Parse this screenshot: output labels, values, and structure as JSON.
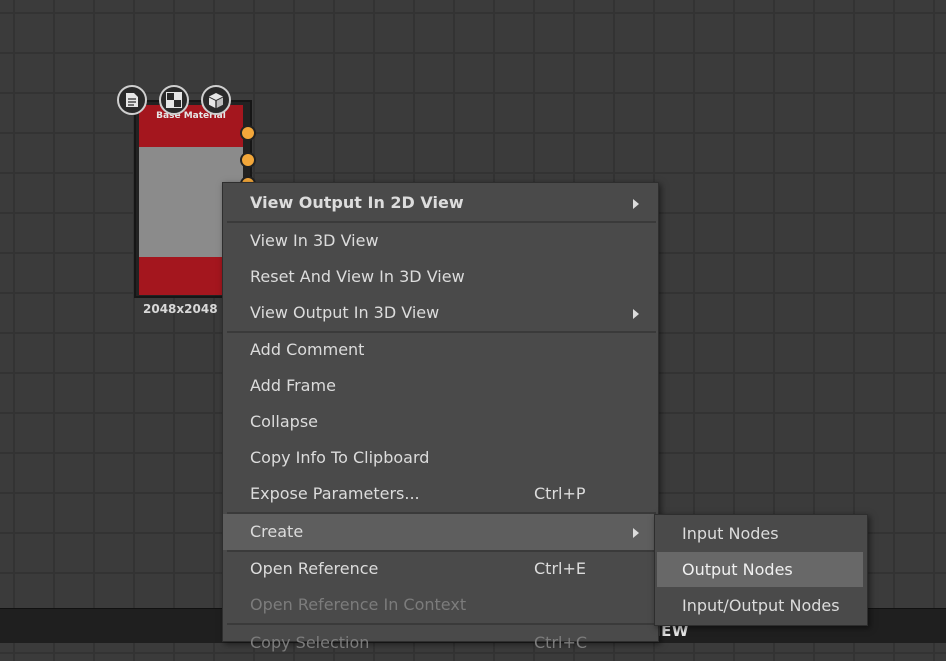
{
  "node": {
    "title": "Base Material",
    "size_label": "2048x2048 -",
    "icons": [
      "document-icon",
      "checker-icon",
      "cube-icon"
    ],
    "port_color": "#f3a73a",
    "header_color": "#a4161e"
  },
  "context_menu": {
    "items": [
      {
        "label": "View Output In 2D View",
        "shortcut": "",
        "submenu": true
      },
      {
        "label": "View In 3D View",
        "shortcut": ""
      },
      {
        "label": "Reset And View In 3D View",
        "shortcut": ""
      },
      {
        "label": "View Output In 3D View",
        "shortcut": "",
        "submenu": true
      },
      {
        "label": "Add Comment",
        "shortcut": ""
      },
      {
        "label": "Add Frame",
        "shortcut": ""
      },
      {
        "label": "Collapse",
        "shortcut": ""
      },
      {
        "label": "Copy Info To Clipboard",
        "shortcut": ""
      },
      {
        "label": "Expose Parameters...",
        "shortcut": "Ctrl+P"
      },
      {
        "label": "Create",
        "shortcut": "",
        "submenu": true
      },
      {
        "label": "Open Reference",
        "shortcut": "Ctrl+E"
      },
      {
        "label": "Open Reference In Context",
        "shortcut": ""
      },
      {
        "label": "Copy Selection",
        "shortcut": "Ctrl+C"
      }
    ]
  },
  "create_submenu": {
    "items": [
      {
        "label": "Input Nodes"
      },
      {
        "label": "Output Nodes"
      },
      {
        "label": "Input/Output Nodes"
      }
    ]
  },
  "bottom_bar": {
    "label": "IEW"
  }
}
